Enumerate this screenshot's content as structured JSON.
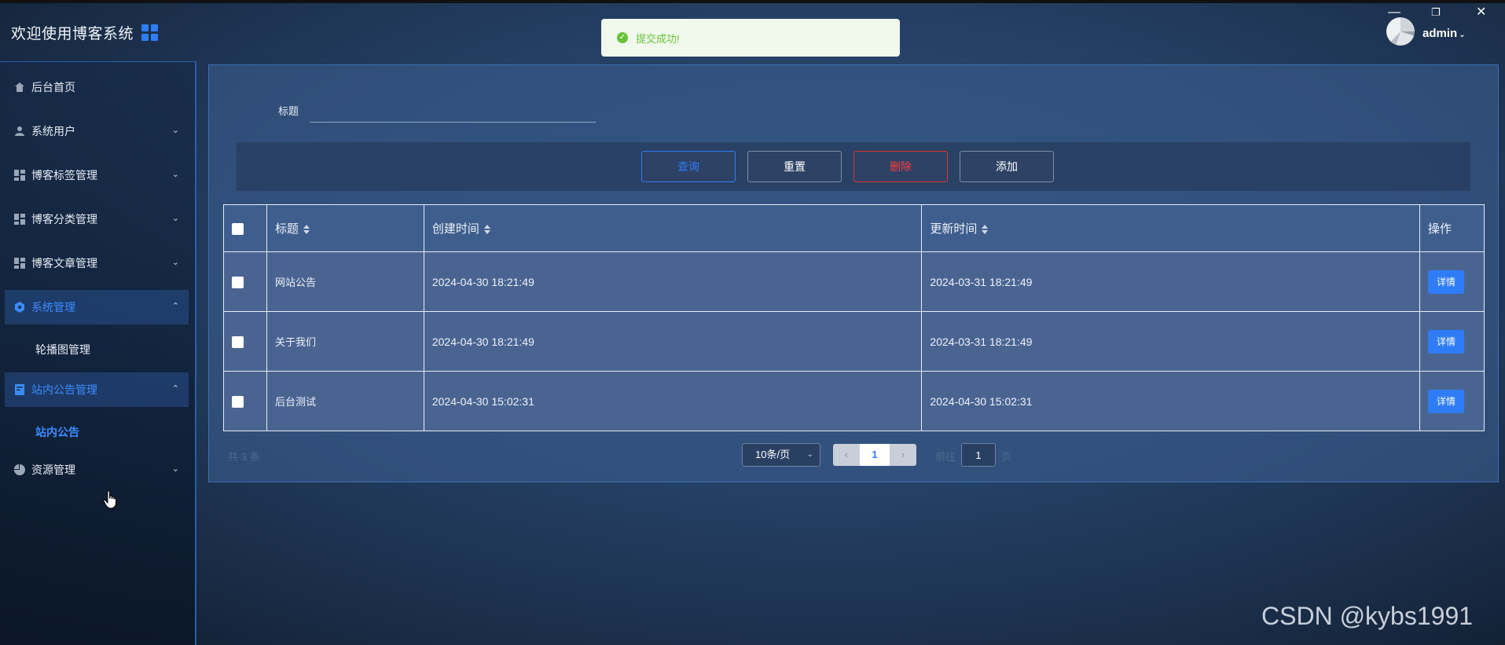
{
  "header": {
    "app_title": "欢迎使用博客系统",
    "user_name": "admin",
    "window_controls": [
      "—",
      "❐",
      "✕"
    ]
  },
  "toast": {
    "message": "提交成功!",
    "color": "#67c23a"
  },
  "sidebar": {
    "items": [
      {
        "label": "后台首页",
        "icon": "home-icon"
      },
      {
        "label": "系统用户",
        "icon": "user-icon"
      },
      {
        "label": "博客标签管理",
        "icon": "dashboard-icon"
      },
      {
        "label": "博客分类管理",
        "icon": "dashboard-icon"
      },
      {
        "label": "博客文章管理",
        "icon": "dashboard-icon"
      },
      {
        "label": "系统管理",
        "icon": "settings-icon"
      },
      {
        "label": "站内公告管理",
        "icon": "notice-icon"
      },
      {
        "label": "资源管理",
        "icon": "pie-chart-icon"
      }
    ],
    "sub_items": {
      "system": "轮播图管理",
      "notice": "站内公告"
    }
  },
  "search": {
    "label": "标题",
    "value": ""
  },
  "toolbar": {
    "query_label": "查询",
    "reset_label": "重置",
    "delete_label": "删除",
    "add_label": "添加"
  },
  "table": {
    "columns": {
      "title": "标题",
      "created": "创建时间",
      "updated": "更新时间",
      "actions": "操作"
    },
    "detail_label": "详情",
    "rows": [
      {
        "title": "网站公告",
        "created": "2024-04-30 18:21:49",
        "updated": "2024-03-31 18:21:49"
      },
      {
        "title": "关于我们",
        "created": "2024-04-30 18:21:49",
        "updated": "2024-03-31 18:21:49"
      },
      {
        "title": "后台测试",
        "created": "2024-04-30 15:02:31",
        "updated": "2024-04-30 15:02:31"
      }
    ]
  },
  "pagination": {
    "total": "共 3 条",
    "page_size": "10条/页",
    "current_page": "1",
    "goto_prefix": "前往",
    "goto_value": "1",
    "goto_suffix": "页"
  },
  "watermark": "CSDN @kybs1991",
  "colors": {
    "accent": "#2f7df6",
    "danger": "#e03131",
    "success": "#67c23a"
  }
}
